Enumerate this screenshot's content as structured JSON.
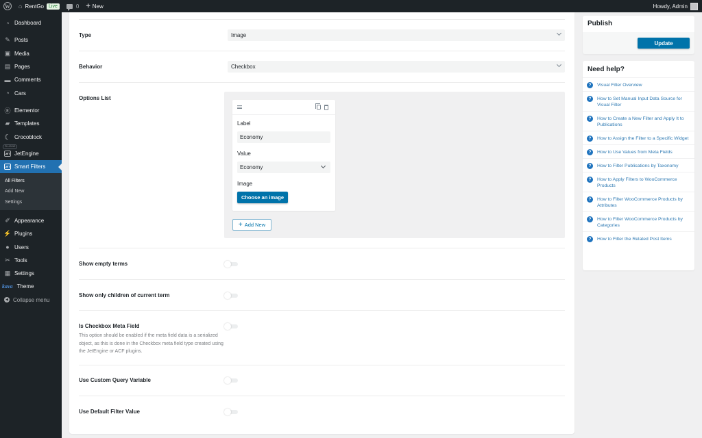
{
  "adminbar": {
    "site_name": "RentGo",
    "live_badge": "Live",
    "comments_count": "0",
    "new_label": "New",
    "greeting": "Howdy, Admin"
  },
  "sidebar": {
    "items": [
      {
        "label": "Dashboard",
        "icon": "dashboard-icon"
      },
      {
        "label": "Posts",
        "icon": "pin-icon"
      },
      {
        "label": "Media",
        "icon": "media-icon"
      },
      {
        "label": "Pages",
        "icon": "pages-icon"
      },
      {
        "label": "Comments",
        "icon": "comment-icon"
      },
      {
        "label": "Cars",
        "icon": "dashboard-icon"
      },
      {
        "label": "Elementor",
        "icon": "elementor-icon"
      },
      {
        "label": "Templates",
        "icon": "folder-icon"
      },
      {
        "label": "Crocoblock",
        "icon": "crocoblock-icon"
      },
      {
        "label": "JetEngine",
        "icon": "jet-icon"
      },
      {
        "label": "Smart Filters",
        "icon": "jet-icon"
      },
      {
        "label": "Appearance",
        "icon": "brush-icon"
      },
      {
        "label": "Plugins",
        "icon": "plug-icon"
      },
      {
        "label": "Users",
        "icon": "user-icon"
      },
      {
        "label": "Tools",
        "icon": "wrench-icon"
      },
      {
        "label": "Settings",
        "icon": "settings-icon"
      },
      {
        "label": "Theme",
        "icon": "kava-icon"
      },
      {
        "label": "Collapse menu",
        "icon": "collapse-icon"
      }
    ],
    "plugins_tag": "PLUGINS",
    "kava_logo": "kava",
    "submenu": [
      "All Filters",
      "Add New",
      "Settings"
    ]
  },
  "main": {
    "type": {
      "label": "Type",
      "value": "Image"
    },
    "behavior": {
      "label": "Behavior",
      "value": "Checkbox"
    },
    "options_list": {
      "label": "Options List",
      "item": {
        "label_caption": "Label",
        "label_value": "Economy",
        "value_caption": "Value",
        "value_value": "Economy",
        "image_caption": "Image",
        "choose_image": "Choose an image"
      },
      "add_new": "Add New"
    },
    "toggles": [
      {
        "label": "Show empty terms",
        "on": false
      },
      {
        "label": "Show only children of current term",
        "on": false
      },
      {
        "label": "Is Checkbox Meta Field",
        "on": false,
        "description": "This option should be enabled if the meta field data is a serialized object, as this is done in the Checkbox meta field type created using the JetEngine or ACF plugins."
      },
      {
        "label": "Use Custom Query Variable",
        "on": false
      },
      {
        "label": "Use Default Filter Value",
        "on": false
      }
    ]
  },
  "publish": {
    "title": "Publish",
    "update_label": "Update"
  },
  "help": {
    "title": "Need help?",
    "links": [
      "Visual Filter Overview",
      "How to Set Manual Input Data Source for Visual Filter",
      "How to Create a New Filter and Apply It to Publications",
      "How to Assign the Filter to a Specific Widget",
      "How to Use Values from Meta Fields",
      "How to Filter Publications by Taxonomy",
      "How to Apply Filters to WooCommerce Products",
      "How to Filter WooCommerce Products by Attributes",
      "How to Filter WooCommerce Products by Categories",
      "How to Filter the Related Post Items"
    ]
  },
  "colors": {
    "accent": "#0073aa",
    "admin_bar": "#1d2327",
    "active_menu": "#2271b1",
    "help_link": "#2f7ab3"
  }
}
